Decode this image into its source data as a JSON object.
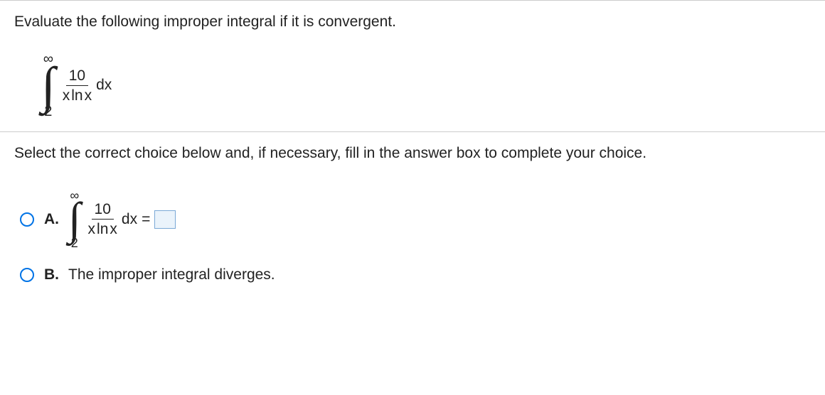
{
  "prompt": "Evaluate the following improper integral if it is convergent.",
  "integral": {
    "upper": "∞",
    "lower": "2",
    "numerator": "10",
    "denominator_pre": "x",
    "denominator_ln": "ln",
    "denominator_post": "x",
    "dx": "dx"
  },
  "instruction": "Select the correct choice below and, if necessary, fill in the answer box to complete your choice.",
  "choices": {
    "a": {
      "letter": "A.",
      "integral": {
        "upper": "∞",
        "lower": "2",
        "numerator": "10",
        "denominator_pre": "x",
        "denominator_ln": "ln",
        "denominator_post": "x",
        "dx": "dx",
        "equals": "="
      }
    },
    "b": {
      "letter": "B.",
      "text": "The improper integral diverges."
    }
  }
}
